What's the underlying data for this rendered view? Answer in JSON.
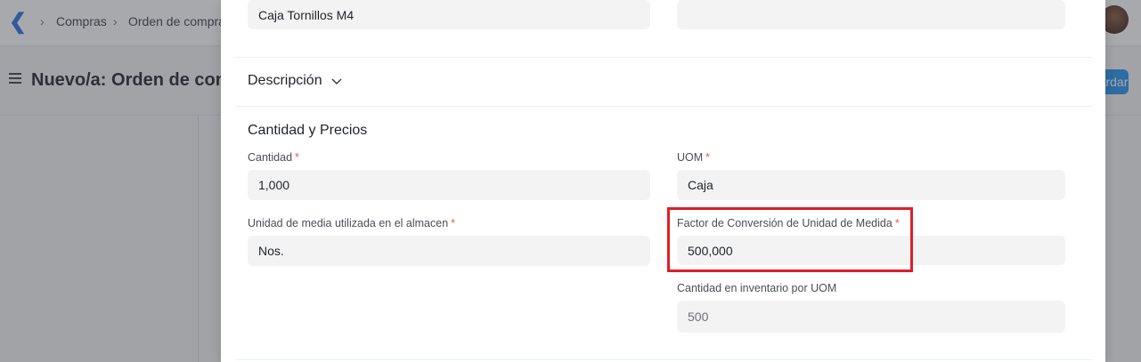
{
  "topbar": {
    "breadcrumb": [
      "Compras",
      "Orden de compra"
    ]
  },
  "header": {
    "title": "Nuevo/a: Orden de compra",
    "save_label": "Guardar"
  },
  "modal": {
    "item_name_value": "Caja Tornillos M4",
    "item_right_value": "",
    "description_section": "Descripción",
    "qty_section": "Cantidad y Precios",
    "fields": {
      "cantidad": {
        "label": "Cantidad",
        "value": "1,000",
        "required": "*"
      },
      "uom": {
        "label": "UOM",
        "value": "Caja",
        "required": "*"
      },
      "stock_uom": {
        "label": "Unidad de media utilizada en el almacen",
        "value": "Nos.",
        "required": "*"
      },
      "conversion_factor": {
        "label": "Factor de Conversión de Unidad de Medida",
        "value": "500,000",
        "required": "*"
      },
      "stock_qty": {
        "label": "Cantidad en inventario por UOM",
        "value": "500"
      }
    }
  },
  "colors": {
    "accent": "#2490ef",
    "required": "#e8603c",
    "highlight": "#e01e26"
  }
}
